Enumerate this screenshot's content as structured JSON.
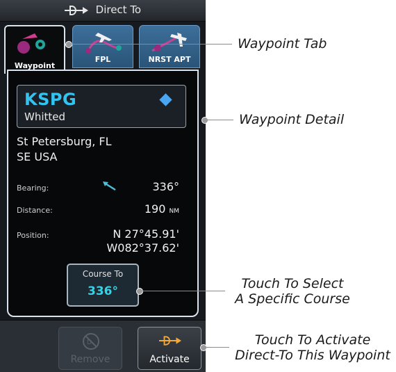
{
  "window": {
    "title": "Direct To"
  },
  "tabs": [
    {
      "label": "Waypoint",
      "active": true
    },
    {
      "label": "FPL",
      "active": false
    },
    {
      "label": "NRST APT",
      "active": false
    }
  ],
  "waypoint": {
    "ident": "KSPG",
    "name": "Whitted",
    "city": "St Petersburg, FL",
    "region": "SE USA",
    "bearing_label": "Bearing:",
    "bearing_value": "336°",
    "distance_label": "Distance:",
    "distance_value": "190",
    "distance_unit": "NM",
    "position_label": "Position:",
    "position_lat": "N 27°45.91'",
    "position_lon": "W082°37.62'"
  },
  "course": {
    "label": "Course To",
    "value": "336°"
  },
  "bottom": {
    "remove_label": "Remove",
    "activate_label": "Activate"
  },
  "callouts": {
    "waypoint_tab": "Waypoint Tab",
    "waypoint_detail": "Waypoint Detail",
    "select_course_1": "Touch To Select",
    "select_course_2": "A Specific Course",
    "activate_1": "Touch To Activate",
    "activate_2": "Direct-To This Waypoint"
  },
  "colors": {
    "ident": "#33c3f0",
    "course": "#33d3e8",
    "tab": "#3d6f9a"
  }
}
